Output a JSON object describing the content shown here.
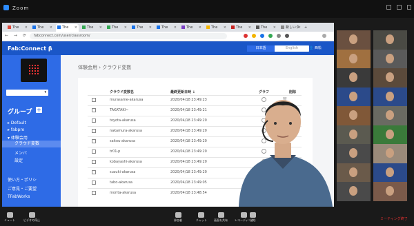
{
  "window": {
    "title": "Zoom"
  },
  "browser": {
    "tabs": [
      {
        "label": "The",
        "color": "#e04b3c"
      },
      {
        "label": "The",
        "color": "#1a73e8"
      },
      {
        "label": "The",
        "color": "#1a73e8"
      },
      {
        "label": "The",
        "color": "#34a853"
      },
      {
        "label": "The",
        "color": "#34a853"
      },
      {
        "label": "The",
        "color": "#1a73e8"
      },
      {
        "label": "The",
        "color": "#1a73e8"
      },
      {
        "label": "The",
        "color": "#7b3fc4"
      },
      {
        "label": "The",
        "color": "#f4b400"
      },
      {
        "label": "The",
        "color": "#c5221f"
      },
      {
        "label": "The",
        "color": "#555555"
      },
      {
        "label": "新しいタブ",
        "color": "#888888"
      }
    ],
    "url": "fabconnect.com/user/classroom/"
  },
  "app": {
    "logo": "Fab:Connect β",
    "lang_ja": "日本語",
    "lang_en": "English",
    "user": "西松"
  },
  "sidebar": {
    "group_title": "グループ",
    "add": "+",
    "select_value": "▾",
    "items": [
      {
        "label": "▸ Default",
        "active": false
      },
      {
        "label": "▸ fabpro",
        "active": false
      },
      {
        "label": "▾ 体験会用",
        "active": false
      },
      {
        "label": "クラウド変数",
        "active": true
      },
      {
        "label": "メンバ",
        "active": false
      },
      {
        "label": "設定",
        "active": false
      }
    ],
    "footer": [
      {
        "label": "使い方・ポリシ"
      },
      {
        "label": "ご意見・ご要望"
      },
      {
        "label": "TFabWorks"
      }
    ]
  },
  "main": {
    "breadcrumb": "体験会用  ›  クラウド変数",
    "headers": {
      "name": "クラウド変数名",
      "date": "最終更新日時 ↓",
      "graph": "グラフ",
      "delete": "削除"
    },
    "rows": [
      {
        "name": "murasame-akarusa",
        "date": "2020/04/18 23:49:23"
      },
      {
        "name": "TAKATAKI~",
        "date": "2020/04/18 23:49:21"
      },
      {
        "name": "toyota-akarusa",
        "date": "2020/04/18 23:49:20"
      },
      {
        "name": "nakamura-akarusa",
        "date": "2020/04/18 23:49:20"
      },
      {
        "name": "saitou-akarusa",
        "date": "2020/04/18 23:49:20"
      },
      {
        "name": "tr01-p",
        "date": "2020/04/18 23:49:20"
      },
      {
        "name": "kobayashi-akarusa",
        "date": "2020/04/18 23:49:20"
      },
      {
        "name": "suzuki-akarusa",
        "date": "2020/04/18 23:49:20"
      },
      {
        "name": "tabo-akarusa",
        "date": "2020/04/18 23:49:05"
      },
      {
        "name": "morita-akarusa",
        "date": "2020/04/18 23:48:54"
      }
    ]
  },
  "gallery": {
    "tiles": [
      {
        "name": "",
        "color": "#6a5040"
      },
      {
        "name": "",
        "color": "#4a4a44"
      },
      {
        "name": "",
        "color": "#a07040"
      },
      {
        "name": "",
        "color": "#5a5a5a"
      },
      {
        "name": "",
        "color": "#3a3a3a"
      },
      {
        "name": "",
        "color": "#5b4a3b"
      },
      {
        "name": "",
        "color": "#2b4a8a"
      },
      {
        "name": "",
        "color": "#2b4a8a"
      },
      {
        "name": "",
        "color": "#805838"
      },
      {
        "name": "",
        "color": "#6a6a62"
      },
      {
        "name": "",
        "color": "#5b5a50"
      },
      {
        "name": "",
        "color": "#3a7a3a"
      },
      {
        "name": "",
        "color": "#4a4a4a"
      },
      {
        "name": "",
        "color": "#9a8a7a"
      },
      {
        "name": "",
        "color": "#6a5a4a"
      },
      {
        "name": "",
        "color": "#2b4a8a"
      },
      {
        "name": "",
        "color": "#4a4a4a"
      },
      {
        "name": "",
        "color": "#7a5a4a"
      }
    ]
  },
  "bottom": {
    "buttons": [
      {
        "label": "ミュート",
        "icon": "mic-icon"
      },
      {
        "label": "ビデオの停止",
        "icon": "video-icon"
      },
      {
        "label": "参加者",
        "icon": "participants-icon"
      },
      {
        "label": "チャット",
        "icon": "chat-icon"
      },
      {
        "label": "画面を共有",
        "icon": "share-icon"
      },
      {
        "label": "レコーディング",
        "icon": "record-icon"
      },
      {
        "label": "反応",
        "icon": "reaction-icon"
      }
    ],
    "leave": "ミーティング終了"
  }
}
